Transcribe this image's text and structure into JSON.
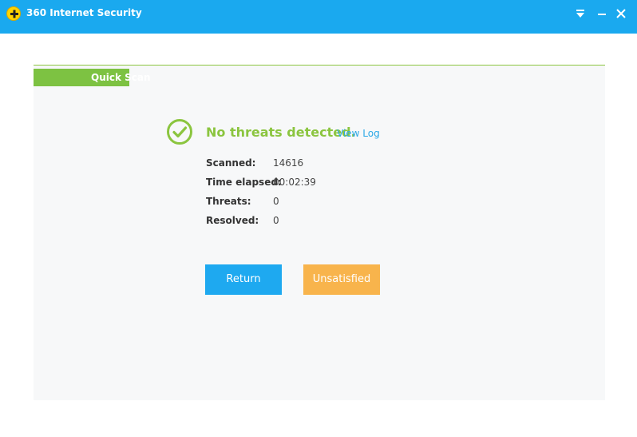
{
  "window": {
    "title": "360 Internet Security"
  },
  "scan": {
    "tab_label": "Quick Scan"
  },
  "result": {
    "status": "No threats detected.",
    "view_log": "View Log"
  },
  "stats": [
    {
      "label": "Scanned:",
      "value": "14616"
    },
    {
      "label": "Time elapsed:",
      "value": "00:02:39"
    },
    {
      "label": "Threats:",
      "value": "0"
    },
    {
      "label": "Resolved:",
      "value": "0"
    }
  ],
  "actions": {
    "return_label": "Return",
    "unsatisfied_label": "Unsatisfied"
  },
  "colors": {
    "titlebar": "#1aa9ef",
    "accent_green": "#8bc53f",
    "link_blue": "#2aa8e6",
    "button_blue": "#1ea9f0",
    "button_orange": "#f8b44c"
  }
}
